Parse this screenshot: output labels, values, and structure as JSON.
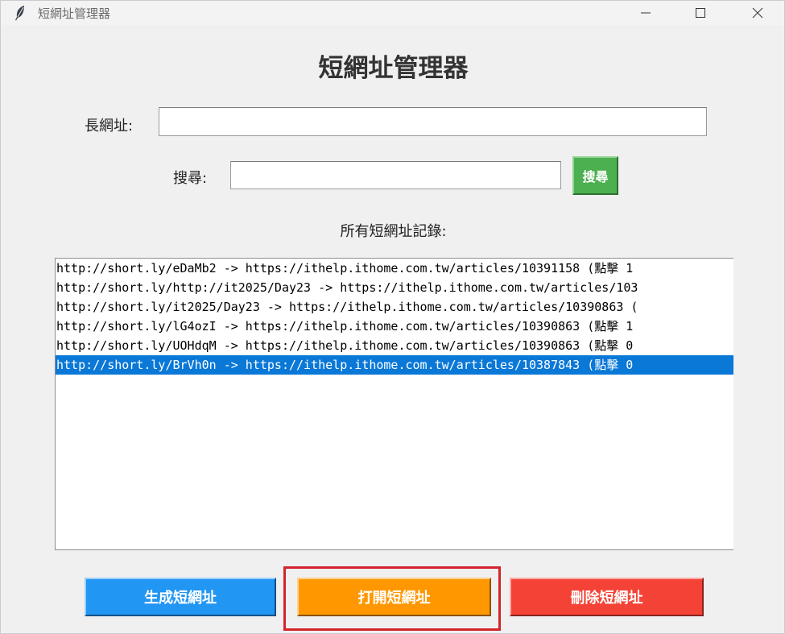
{
  "window": {
    "title": "短網址管理器",
    "icon": "feather-icon"
  },
  "heading": "短網址管理器",
  "long_url": {
    "label": "長網址:",
    "value": "",
    "placeholder": ""
  },
  "search": {
    "label": "搜尋:",
    "value": "",
    "placeholder": "",
    "button_label": "搜尋"
  },
  "records": {
    "label": "所有短網址記錄:",
    "items": [
      "http://short.ly/eDaMb2 -> https://ithelp.ithome.com.tw/articles/10391158 (點擊 1",
      "http://short.ly/http://it2025/Day23 -> https://ithelp.ithome.com.tw/articles/103",
      "http://short.ly/it2025/Day23 -> https://ithelp.ithome.com.tw/articles/10390863 (",
      "http://short.ly/lG4ozI -> https://ithelp.ithome.com.tw/articles/10390863 (點擊 1",
      "http://short.ly/UOHdqM -> https://ithelp.ithome.com.tw/articles/10390863 (點擊 0",
      "http://short.ly/BrVh0n -> https://ithelp.ithome.com.tw/articles/10387843 (點擊 0"
    ],
    "selected_index": 5
  },
  "buttons": {
    "generate": "生成短網址",
    "open": "打開短網址",
    "delete": "刪除短網址"
  },
  "colors": {
    "search_button": "#4caf50",
    "generate_button": "#2196f3",
    "open_button": "#ff9800",
    "delete_button": "#f44336",
    "selection": "#0a78d7",
    "highlight_box": "#d4242b"
  }
}
